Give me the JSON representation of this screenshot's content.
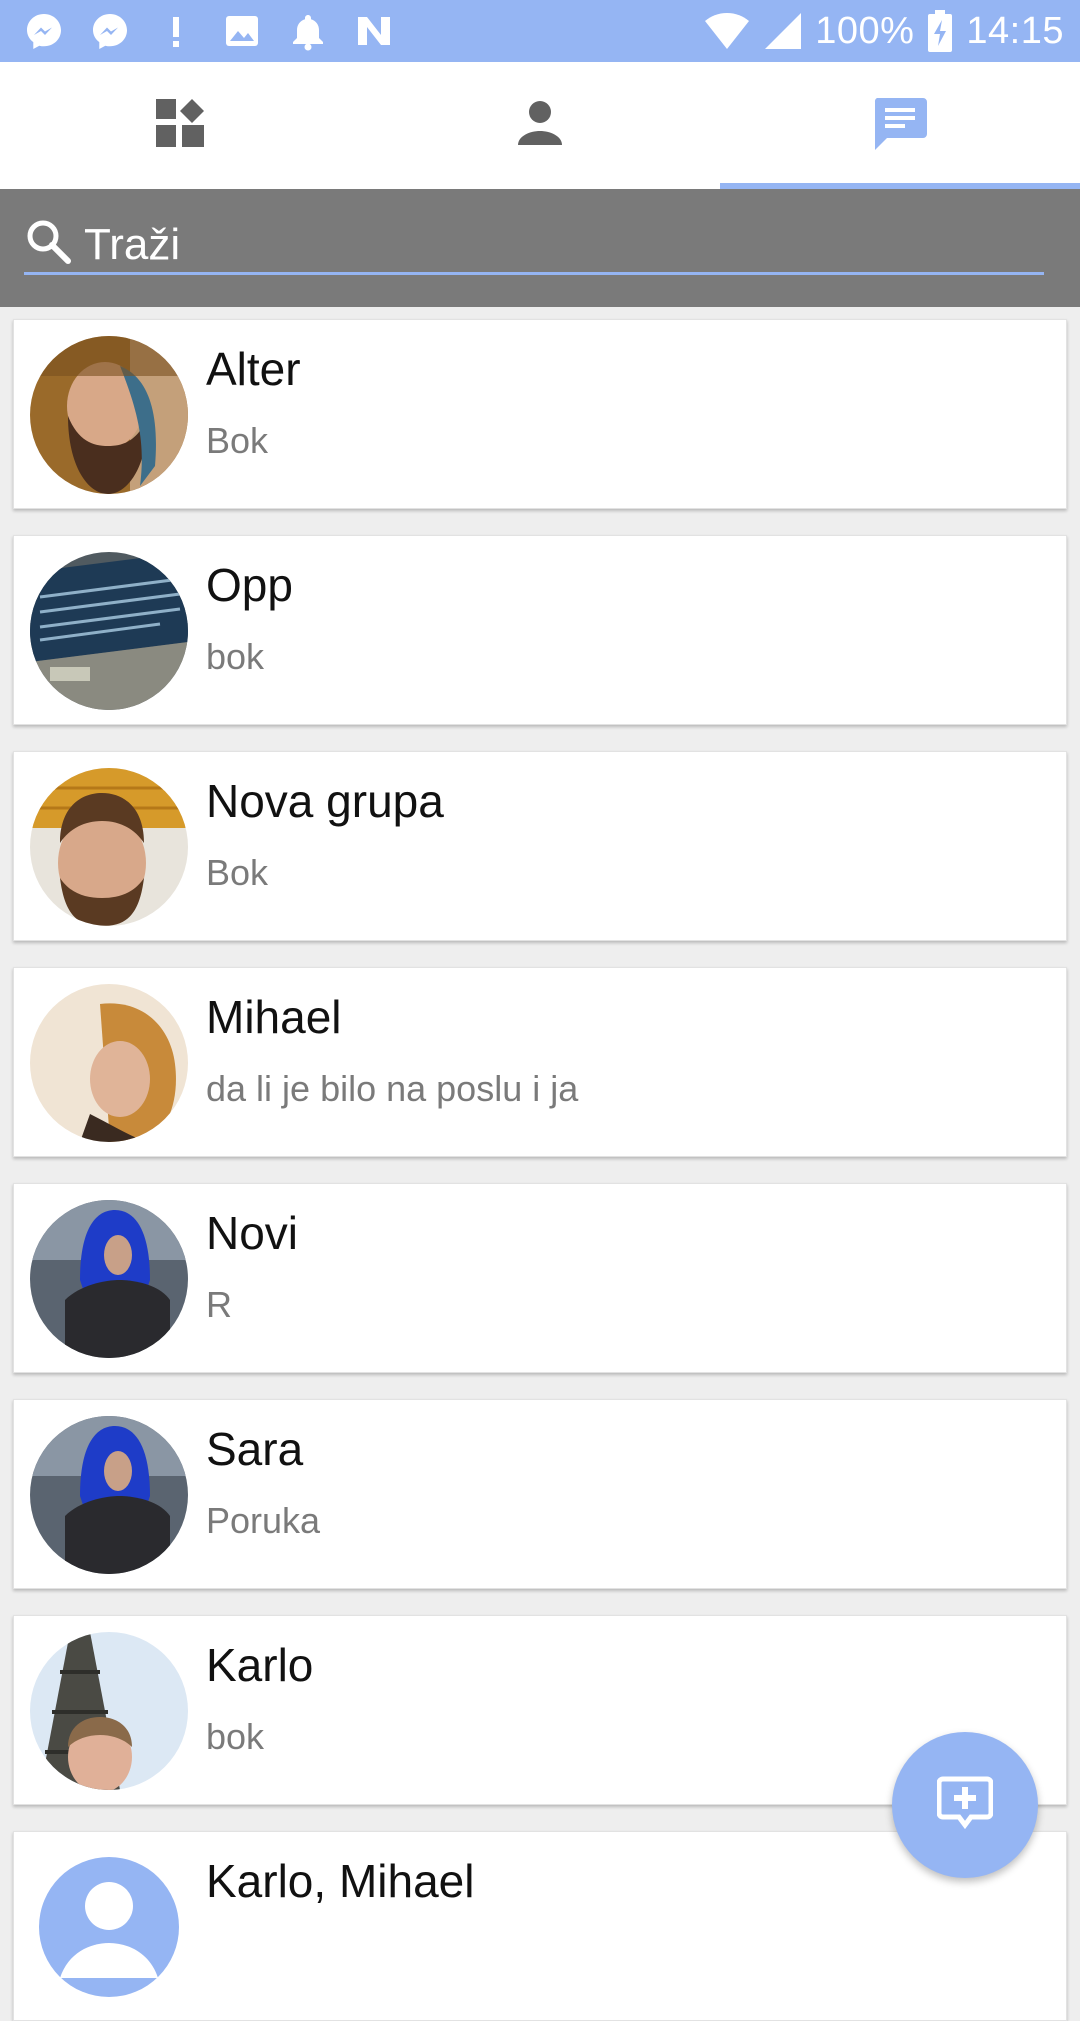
{
  "status_bar": {
    "battery_percent": "100%",
    "time": "14:15",
    "icons": [
      "messenger-icon",
      "messenger-icon",
      "alert-icon",
      "image-icon",
      "bell-icon",
      "n-logo-icon",
      "wifi-icon",
      "signal-icon",
      "battery-charging-icon"
    ]
  },
  "tabs": [
    {
      "icon": "dashboard-icon",
      "active": false
    },
    {
      "icon": "person-icon",
      "active": false
    },
    {
      "icon": "chat-icon",
      "active": true
    }
  ],
  "search": {
    "placeholder": "Traži"
  },
  "chats": [
    {
      "name": "Alter",
      "preview": "Bok",
      "avatar": "photo"
    },
    {
      "name": "Opp",
      "preview": "bok",
      "avatar": "photo"
    },
    {
      "name": "Nova grupa",
      "preview": "Bok",
      "avatar": "photo"
    },
    {
      "name": "Mihael",
      "preview": "da li je bilo na poslu i ja",
      "avatar": "photo"
    },
    {
      "name": "Novi",
      "preview": "R",
      "avatar": "photo"
    },
    {
      "name": "Sara",
      "preview": "Poruka",
      "avatar": "photo"
    },
    {
      "name": "Karlo",
      "preview": "bok",
      "avatar": "photo"
    },
    {
      "name": "Karlo, Mihael",
      "preview": "",
      "avatar": "default-person-icon"
    }
  ],
  "fab": {
    "icon": "add-chat-icon"
  },
  "colors": {
    "accent": "#95b5f3",
    "search_bg": "#7a7a7a",
    "icon_gray": "#616161"
  }
}
